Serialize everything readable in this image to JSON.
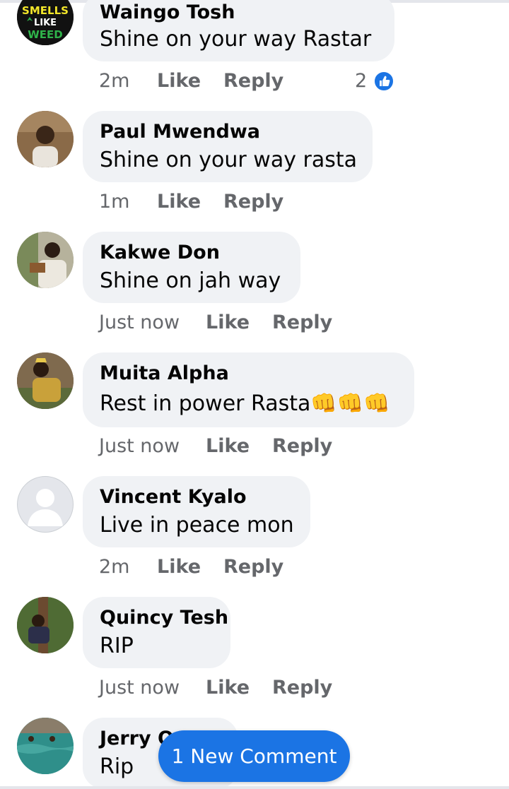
{
  "comments": [
    {
      "name": "Waingo Tosh",
      "text": "Shine on your way Rastar",
      "time": "2m",
      "like": "Like",
      "reply": "Reply",
      "reaction_count": "2",
      "avatar": "smells-like-weed-avatar"
    },
    {
      "name": "Paul Mwendwa",
      "text": "Shine on your way rasta",
      "time": "1m",
      "like": "Like",
      "reply": "Reply",
      "avatar": "photo-avatar"
    },
    {
      "name": "Kakwe Don",
      "text": "Shine on jah way",
      "time": "Just now",
      "like": "Like",
      "reply": "Reply",
      "avatar": "photo-avatar"
    },
    {
      "name": "Muita Alpha",
      "text": "Rest in power Rasta👊👊👊",
      "time": "Just now",
      "like": "Like",
      "reply": "Reply",
      "avatar": "photo-avatar"
    },
    {
      "name": "Vincent Kyalo",
      "text": "Live in peace mon",
      "time": "2m",
      "like": "Like",
      "reply": "Reply",
      "avatar": "default-avatar"
    },
    {
      "name": "Quincy Tesh",
      "text": "RIP",
      "time": "Just now",
      "like": "Like",
      "reply": "Reply",
      "avatar": "photo-avatar"
    },
    {
      "name": "Jerry O",
      "text": "Rip",
      "avatar": "photo-avatar"
    }
  ],
  "avatar_logo": {
    "line1": "SMELLS",
    "line2": "LIKE",
    "line3": "WEED"
  },
  "new_comment_button": "1 New Comment",
  "colors": {
    "accent": "#1b74e4",
    "bubble": "#f0f2f5",
    "meta": "#65676b"
  }
}
